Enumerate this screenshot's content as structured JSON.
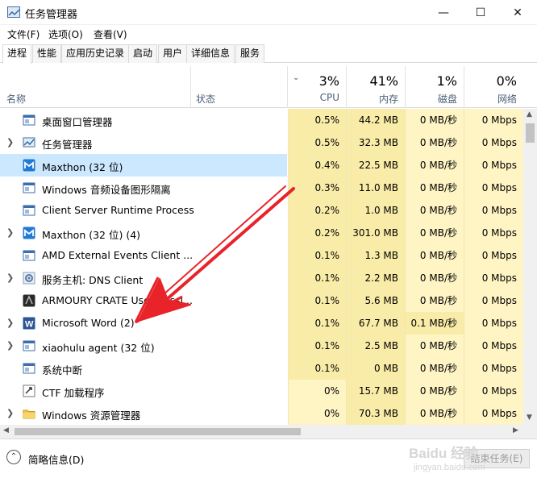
{
  "window": {
    "title": "任务管理器",
    "minimize": "—",
    "maximize": "☐",
    "close": "✕"
  },
  "menu": [
    "文件(F)",
    "选项(O)",
    "查看(V)"
  ],
  "tabs": [
    "进程",
    "性能",
    "应用历史记录",
    "启动",
    "用户",
    "详细信息",
    "服务"
  ],
  "active_tab": 0,
  "header": {
    "name": "名称",
    "status": "状态",
    "cpu": {
      "pct": "3%",
      "label": "CPU"
    },
    "memory": {
      "pct": "41%",
      "label": "内存"
    },
    "disk": {
      "pct": "1%",
      "label": "磁盘"
    },
    "network": {
      "pct": "0%",
      "label": "网络"
    }
  },
  "rows": [
    {
      "name": "桌面窗口管理器",
      "icon": "window-icon",
      "expandable": false,
      "cpu": "0.5%",
      "mem": "44.2 MB",
      "disk": "0 MB/秒",
      "net": "0 Mbps"
    },
    {
      "name": "任务管理器",
      "icon": "taskmgr-icon",
      "expandable": true,
      "cpu": "0.5%",
      "mem": "32.3 MB",
      "disk": "0 MB/秒",
      "net": "0 Mbps"
    },
    {
      "name": "Maxthon (32 位)",
      "icon": "maxthon-icon",
      "expandable": false,
      "selected": true,
      "cpu": "0.4%",
      "mem": "22.5 MB",
      "disk": "0 MB/秒",
      "net": "0 Mbps"
    },
    {
      "name": "Windows 音频设备图形隔离",
      "icon": "window-icon",
      "expandable": false,
      "cpu": "0.3%",
      "mem": "11.0 MB",
      "disk": "0 MB/秒",
      "net": "0 Mbps"
    },
    {
      "name": "Client Server Runtime Process",
      "icon": "window-icon",
      "expandable": false,
      "cpu": "0.2%",
      "mem": "1.0 MB",
      "disk": "0 MB/秒",
      "net": "0 Mbps"
    },
    {
      "name": "Maxthon (32 位) (4)",
      "icon": "maxthon-icon",
      "expandable": true,
      "cpu": "0.2%",
      "mem": "301.0 MB",
      "disk": "0 MB/秒",
      "net": "0 Mbps"
    },
    {
      "name": "AMD External Events Client ...",
      "icon": "window-icon",
      "expandable": false,
      "cpu": "0.1%",
      "mem": "1.3 MB",
      "disk": "0 MB/秒",
      "net": "0 Mbps"
    },
    {
      "name": "服务主机: DNS Client",
      "icon": "gear-icon",
      "expandable": true,
      "cpu": "0.1%",
      "mem": "2.2 MB",
      "disk": "0 MB/秒",
      "net": "0 Mbps"
    },
    {
      "name": "ARMOURY CRATE User Sessi...",
      "icon": "armoury-icon",
      "expandable": false,
      "cpu": "0.1%",
      "mem": "5.6 MB",
      "disk": "0 MB/秒",
      "net": "0 Mbps"
    },
    {
      "name": "Microsoft Word (2)",
      "icon": "word-icon",
      "expandable": true,
      "cpu": "0.1%",
      "mem": "67.7 MB",
      "disk": "0.1 MB/秒",
      "net": "0 Mbps"
    },
    {
      "name": "xiaohulu agent (32 位)",
      "icon": "window-icon",
      "expandable": true,
      "cpu": "0.1%",
      "mem": "2.5 MB",
      "disk": "0 MB/秒",
      "net": "0 Mbps"
    },
    {
      "name": "系统中断",
      "icon": "window-icon",
      "expandable": false,
      "cpu": "0.1%",
      "mem": "0 MB",
      "disk": "0 MB/秒",
      "net": "0 Mbps"
    },
    {
      "name": "CTF 加载程序",
      "icon": "ctf-icon",
      "expandable": false,
      "cpu": "0%",
      "mem": "15.7 MB",
      "disk": "0 MB/秒",
      "net": "0 Mbps"
    },
    {
      "name": "Windows 资源管理器",
      "icon": "folder-icon",
      "expandable": true,
      "cpu": "0%",
      "mem": "70.3 MB",
      "disk": "0 MB/秒",
      "net": "0 Mbps"
    }
  ],
  "footer": {
    "fewer_details": "简略信息(D)",
    "end_task": "结束任务(E)"
  },
  "watermark": {
    "brand": "Baidu 经验",
    "url": "jingyan.baidu.com"
  },
  "colors": {
    "heat_light": "#fff4c4",
    "heat_mid": "#f9eca8",
    "selected": "#cce8ff",
    "arrow": "#e8232a",
    "header_label": "#4c607a"
  }
}
